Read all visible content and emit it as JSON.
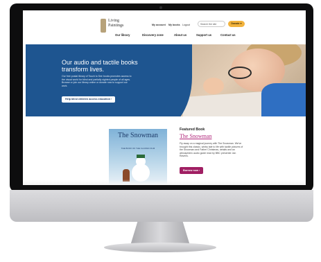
{
  "header": {
    "logo_text": "Living Paintings",
    "utility_links": [
      "My account",
      "My books",
      "Logout"
    ],
    "search_placeholder": "Search the site",
    "donate_label": "Donate ♥",
    "nav_items": [
      "Our library",
      "Discovery zone",
      "About us",
      "Support us",
      "Contact us"
    ]
  },
  "hero": {
    "title": "Our audio and tactile books transform lives.",
    "body": "Our free postal library of Touch to See books promotes access to the visual world for blind and partially sighted people of all ages. Browse or join our library online or donate now to support our work.",
    "cta_label": "Help blind children access education ›"
  },
  "featured": {
    "kicker": "Featured Book",
    "title": "The Snowman",
    "body": "Fly away on a magical journey with The Snowman. We've brought this classic, wintry tale to life with tactile pictures of the Snowman and Father Christmas, details and an atmospheric audio guide read by BBC presenter Jan Ravens.",
    "button_label": "Borrow now ›",
    "cover_title": "The Snowman",
    "cover_subtitle": "THE BOOK OF THE CLASSIC FILM"
  }
}
